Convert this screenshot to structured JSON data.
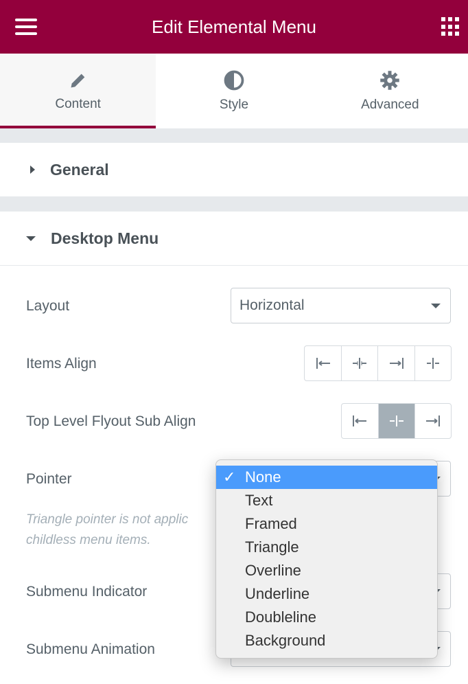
{
  "header": {
    "title": "Edit Elemental Menu",
    "menu_icon": "hamburger-icon",
    "apps_icon": "grid-icon",
    "color": "#93003c"
  },
  "tabs": [
    {
      "label": "Content",
      "icon": "pencil-icon",
      "active": true
    },
    {
      "label": "Style",
      "icon": "half-circle-icon"
    },
    {
      "label": "Advanced",
      "icon": "gear-icon"
    }
  ],
  "sections": {
    "general": "General",
    "desktop_menu": "Desktop Menu"
  },
  "controls": {
    "layout": {
      "label": "Layout",
      "value": "Horizontal"
    },
    "items_align": {
      "label": "Items Align",
      "options": [
        "left",
        "center",
        "right",
        "justify"
      ]
    },
    "flyout_align": {
      "label": "Top Level Flyout Sub Align",
      "options": [
        "left",
        "center",
        "right"
      ],
      "selected": "center"
    },
    "pointer": {
      "label": "Pointer",
      "note": "Triangle pointer is not applic… childless menu items."
    },
    "submenu_indicator": {
      "label": "Submenu Indicator"
    },
    "submenu_animation": {
      "label": "Submenu Animation"
    }
  },
  "note_lines": [
    "Triangle pointer is not applic",
    "childless menu items."
  ],
  "dropdown": {
    "selected": "None",
    "check": "✓",
    "options": [
      "None",
      "Text",
      "Framed",
      "Triangle",
      "Overline",
      "Underline",
      "Doubleline",
      "Background"
    ]
  }
}
